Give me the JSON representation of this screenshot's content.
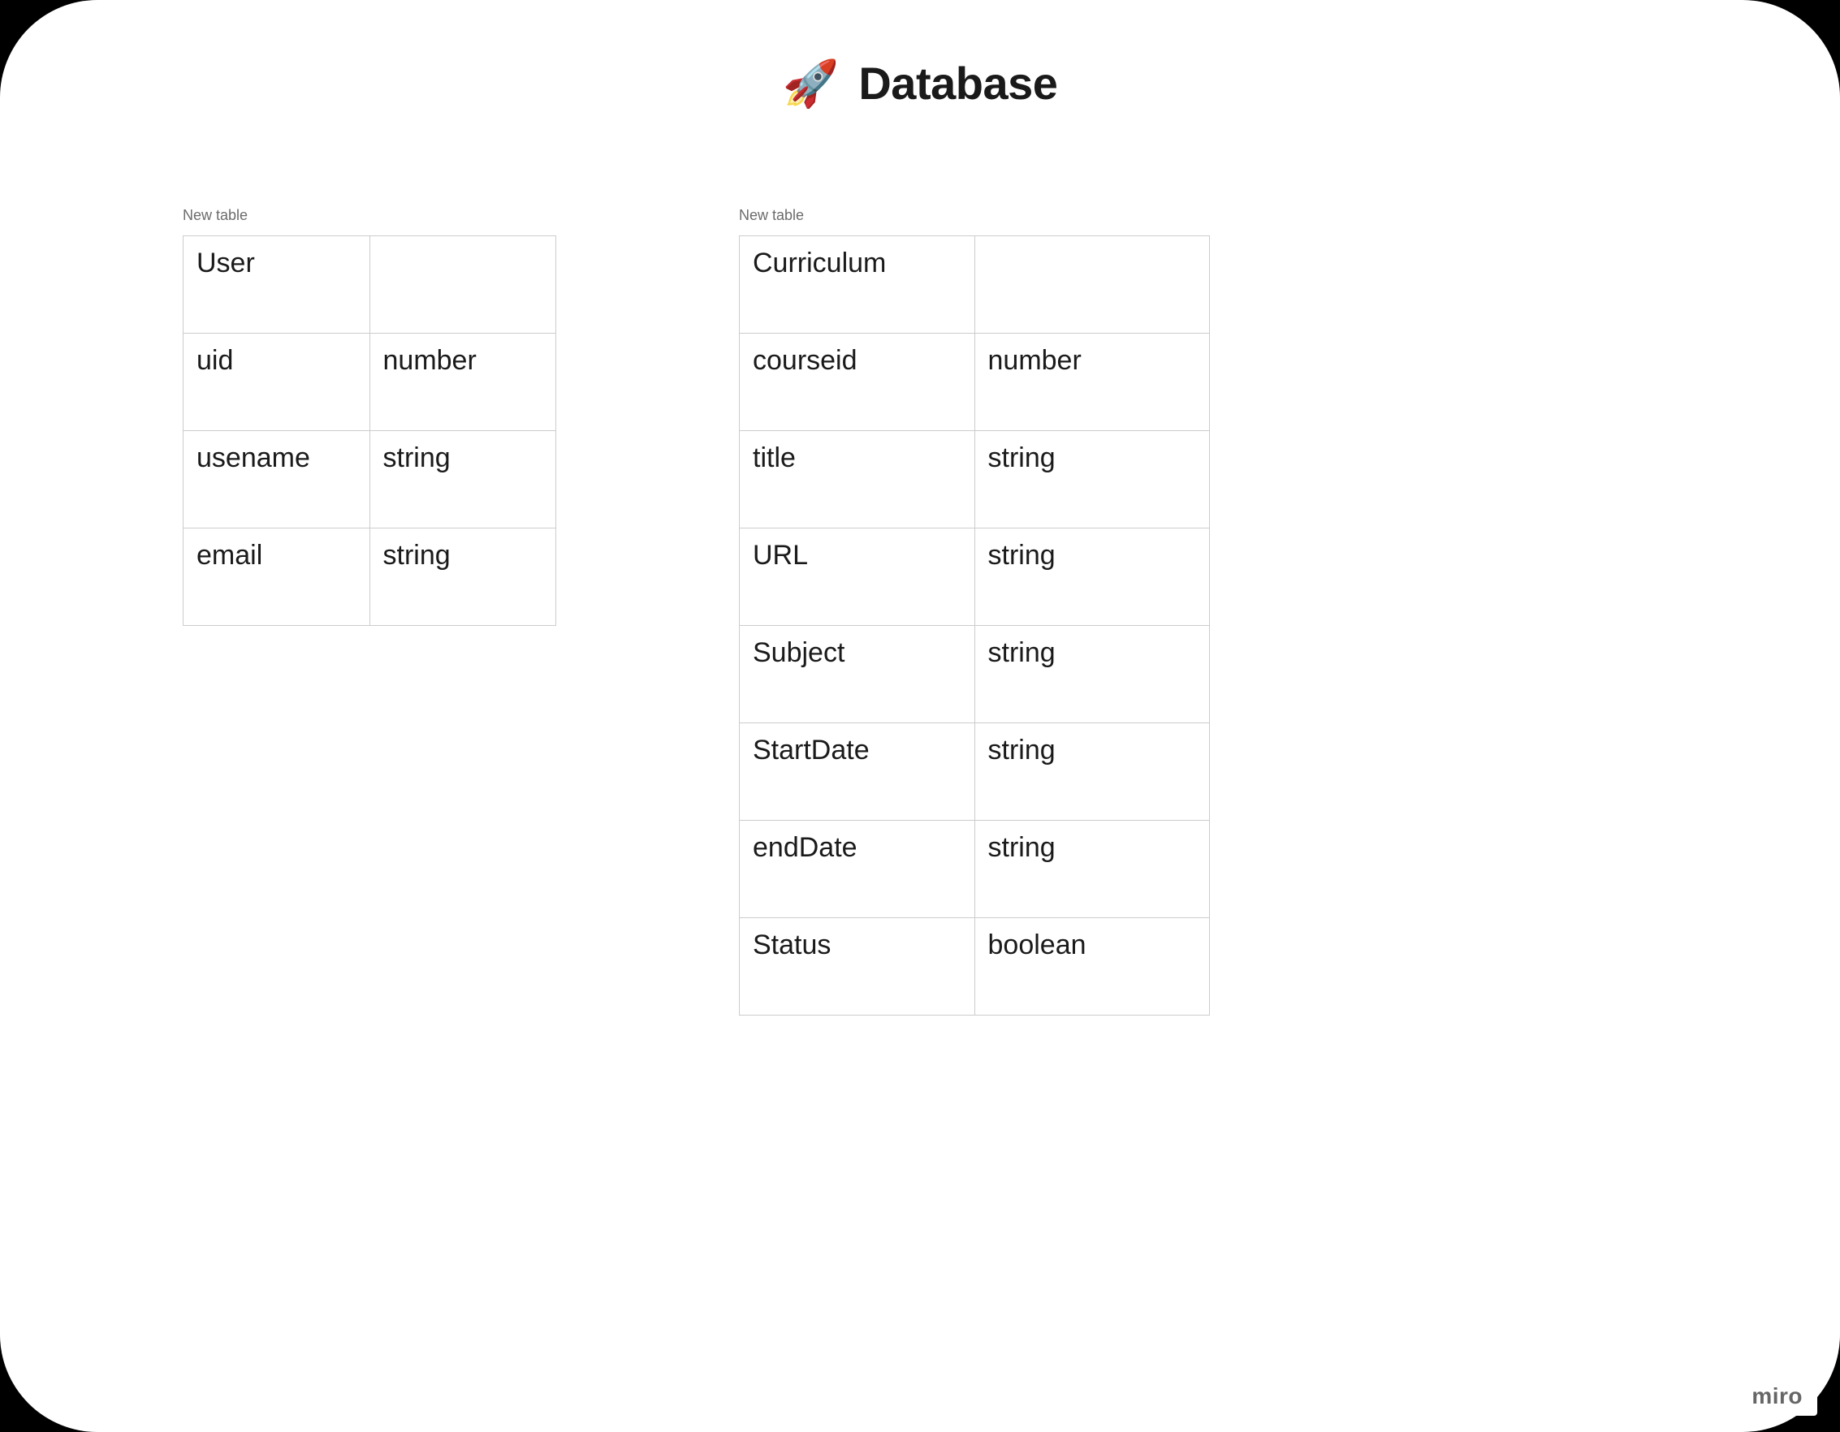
{
  "title": {
    "icon": "🚀",
    "text": "Database"
  },
  "tables": [
    {
      "caption": "New table",
      "name": "User",
      "columns": [
        {
          "name": "uid",
          "type": "number"
        },
        {
          "name": "usename",
          "type": "string"
        },
        {
          "name": "email",
          "type": "string"
        }
      ]
    },
    {
      "caption": "New table",
      "name": "Curriculum",
      "columns": [
        {
          "name": "courseid",
          "type": "number"
        },
        {
          "name": "title",
          "type": "string"
        },
        {
          "name": "URL",
          "type": "string"
        },
        {
          "name": "Subject",
          "type": "string"
        },
        {
          "name": "StartDate",
          "type": "string"
        },
        {
          "name": "endDate",
          "type": "string"
        },
        {
          "name": "Status",
          "type": "boolean"
        }
      ]
    }
  ],
  "brand": "miro"
}
